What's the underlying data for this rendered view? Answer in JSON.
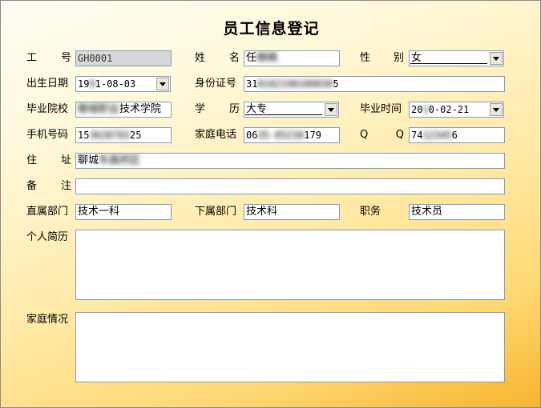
{
  "form_title": "员工信息登记",
  "labels": {
    "emp_id": [
      "工",
      "号"
    ],
    "name": [
      "姓",
      "名"
    ],
    "gender": [
      "性",
      "别"
    ],
    "birth_date": "出生日期",
    "id_card": "身份证号",
    "school": "毕业院校",
    "education": [
      "学",
      "历"
    ],
    "grad_date": "毕业时间",
    "mobile": "手机号码",
    "home_phone": "家庭电话",
    "qq": [
      "Q",
      "Q"
    ],
    "address": [
      "住",
      "址"
    ],
    "remark": [
      "备",
      "注"
    ],
    "direct_dept": "直属部门",
    "sub_dept": "下属部门",
    "position": "职务",
    "resume": "个人简历",
    "family": "家庭情况"
  },
  "values": {
    "emp_id": "GH0001",
    "name_visible": "任",
    "name_blurred": "楠楠",
    "gender": "女",
    "birth_date_a": "19",
    "birth_date_blur": "9",
    "birth_date_b": "1-08-03",
    "id_card_a": "31",
    "id_card_blur": "0102198108030",
    "id_card_b": "5",
    "school_blur": "聊城职业",
    "school_b": "技术学院",
    "education": "大专",
    "grad_date_a": "20",
    "grad_date_blur": "1",
    "grad_date_b": "0-02-21",
    "mobile_a": "15",
    "mobile_blur": "3628765",
    "mobile_b": "25",
    "home_phone_a": "06",
    "home_phone_blur": "35-85230",
    "home_phone_b": "179",
    "qq_a": "74",
    "qq_blur": "12345",
    "qq_b": "6",
    "address_a": "聊城",
    "address_blur": "东昌府区",
    "remark": "",
    "direct_dept": "技术一科",
    "sub_dept": "技术科",
    "position": "技术员",
    "resume": "",
    "family": ""
  }
}
